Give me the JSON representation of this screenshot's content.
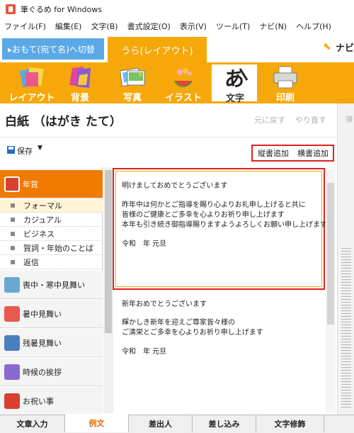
{
  "window": {
    "title": "筆ぐるめ for Windows"
  },
  "menu": [
    "ファイル(F)",
    "編集(E)",
    "文字(B)",
    "書式設定(O)",
    "表示(V)",
    "ツール(T)",
    "ナビ(N)",
    "ヘルプ(H)"
  ],
  "top_tabs": {
    "front": "▸おもて(宛て名)へ切替",
    "back": "うら(レイアウト)",
    "navi": "ナビ"
  },
  "tools": [
    {
      "label": "レイアウト",
      "icon": "layout-icon"
    },
    {
      "label": "背景",
      "icon": "background-icon"
    },
    {
      "label": "写真",
      "icon": "photo-icon"
    },
    {
      "label": "イラスト",
      "icon": "illustration-icon"
    },
    {
      "label": "文字",
      "icon": "text-icon",
      "selected": true
    },
    {
      "label": "印刷",
      "icon": "printer-icon"
    }
  ],
  "panel": {
    "title": "白紙 （はがき たて）",
    "undo": "元に戻す",
    "redo": "やり直す",
    "save": "保存",
    "add_vertical": "縦書追加",
    "add_horizontal": "横書追加",
    "right_tab": "領"
  },
  "categories": {
    "newyear": "年賀",
    "subs": [
      "フォーマル",
      "カジュアル",
      "ビジネス",
      "賀詞・年始のことば",
      "返信"
    ],
    "others": [
      "喪中・寒中見舞い",
      "暑中見舞い",
      "残暑見舞い",
      "時候の挨拶",
      "お祝い事"
    ]
  },
  "card1": {
    "lines": [
      "明けましておめでとうございます",
      "",
      "昨年中は何かとご指導を賜り心よりお礼申し上げると共に",
      "皆様のご健康とご多幸を心よりお祈り申し上げます",
      "本年も引き続き御指導賜りますようよろしくお願い申し上げます",
      "",
      "令和　年 元旦"
    ]
  },
  "card2": {
    "lines": [
      "新年おめでとうございます",
      "",
      "輝かしき新年を迎えご尊家皆々様の",
      "ご清栄とご多幸を心よりお祈り申し上げます",
      "",
      "令和　年 元旦"
    ]
  },
  "bottom_tabs": [
    "文章入力",
    "例文",
    "差出人",
    "差し込み",
    "文字修飾"
  ],
  "colors": {
    "accent": "#f6a80b",
    "blue_tab": "#5aa9e6",
    "highlight": "#e02020",
    "category_selected": "#f07a00"
  }
}
